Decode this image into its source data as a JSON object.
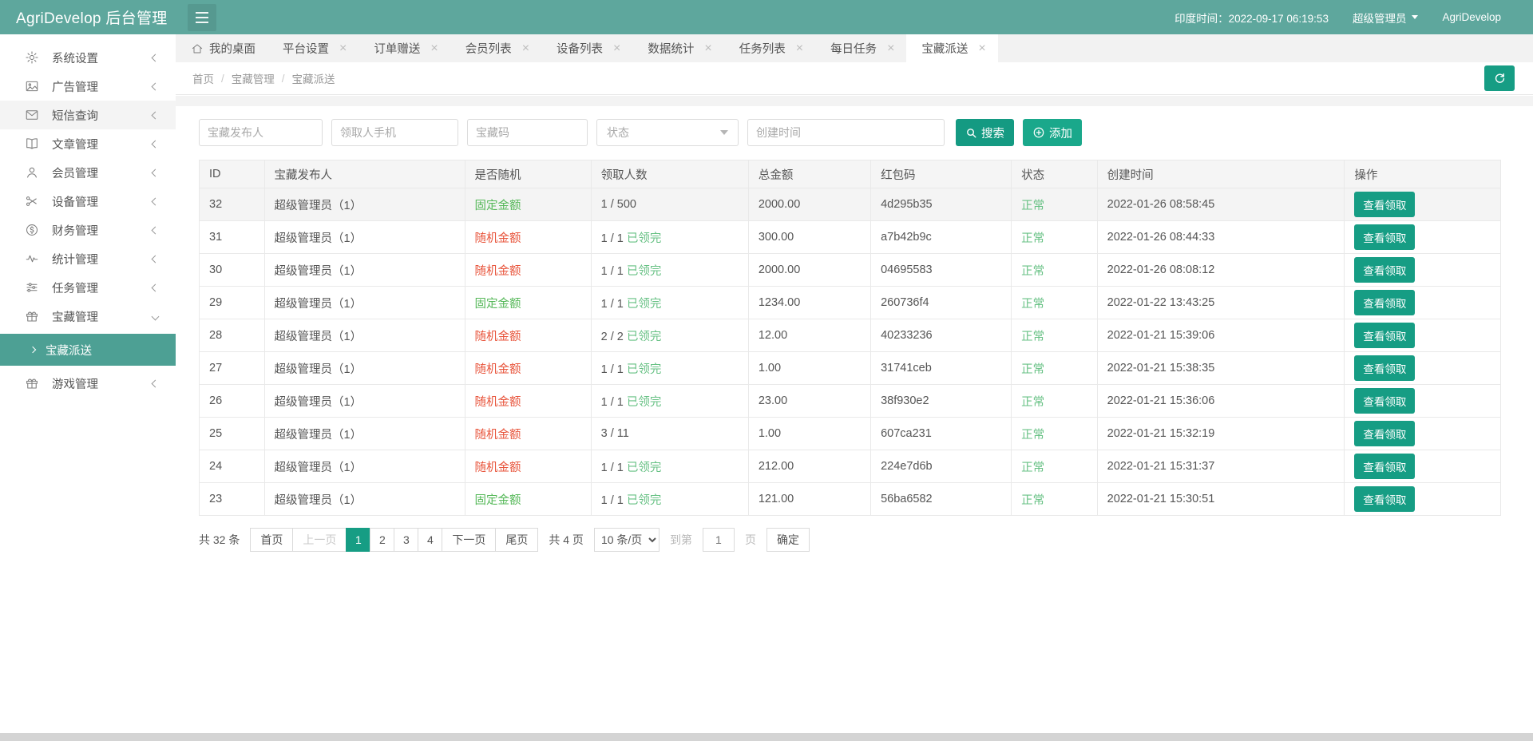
{
  "colors": {
    "header_bg": "#5ea79d",
    "accent_teal": "#169d84",
    "add_green": "#1aa88b",
    "submenu_bg": "#4da094",
    "fixed_amount_green": "#55b858",
    "claimed_green": "#67c184",
    "random_amount_red": "#e8553c"
  },
  "header": {
    "title": "AgriDevelop 后台管理",
    "time_label": "印度时间：",
    "time_value": "2022-09-17 06:19:53",
    "user": "超级管理员",
    "brand": "AgriDevelop"
  },
  "sidebar": {
    "items": [
      {
        "label": "系统设置",
        "icon": "gear-icon",
        "state": "collapsed"
      },
      {
        "label": "广告管理",
        "icon": "image-icon",
        "state": "collapsed"
      },
      {
        "label": "短信查询",
        "icon": "mail-icon",
        "state": "collapsed",
        "highlight": true
      },
      {
        "label": "文章管理",
        "icon": "book-icon",
        "state": "collapsed"
      },
      {
        "label": "会员管理",
        "icon": "user-icon",
        "state": "collapsed"
      },
      {
        "label": "设备管理",
        "icon": "tools-icon",
        "state": "collapsed"
      },
      {
        "label": "财务管理",
        "icon": "finance-icon",
        "state": "collapsed"
      },
      {
        "label": "统计管理",
        "icon": "stats-icon",
        "state": "collapsed"
      },
      {
        "label": "任务管理",
        "icon": "tasks-icon",
        "state": "collapsed"
      },
      {
        "label": "宝藏管理",
        "icon": "gift-icon",
        "state": "expanded",
        "children": [
          {
            "label": "宝藏派送",
            "active": true
          }
        ]
      },
      {
        "label": "游戏管理",
        "icon": "gift-icon",
        "state": "collapsed"
      }
    ]
  },
  "tabs": [
    {
      "label": "我的桌面",
      "icon": "home-icon",
      "closable": false,
      "active": false
    },
    {
      "label": "平台设置",
      "closable": true,
      "active": false
    },
    {
      "label": "订单赠送",
      "closable": true,
      "active": false
    },
    {
      "label": "会员列表",
      "closable": true,
      "active": false
    },
    {
      "label": "设备列表",
      "closable": true,
      "active": false
    },
    {
      "label": "数据统计",
      "closable": true,
      "active": false
    },
    {
      "label": "任务列表",
      "closable": true,
      "active": false
    },
    {
      "label": "每日任务",
      "closable": true,
      "active": false
    },
    {
      "label": "宝藏派送",
      "closable": true,
      "active": true
    }
  ],
  "breadcrumb": [
    "首页",
    "宝藏管理",
    "宝藏派送"
  ],
  "filters": {
    "publisher_placeholder": "宝藏发布人",
    "phone_placeholder": "领取人手机",
    "code_placeholder": "宝藏码",
    "status_placeholder": "状态",
    "created_placeholder": "创建时间",
    "search_label": "搜索",
    "add_label": "添加"
  },
  "table": {
    "columns": [
      "ID",
      "宝藏发布人",
      "是否随机",
      "领取人数",
      "总金额",
      "红包码",
      "状态",
      "创建时间",
      "操作"
    ],
    "action_label": "查看领取",
    "rows": [
      {
        "id": "32",
        "publisher": "超级管理员（1）",
        "random": "固定金额",
        "random_type": "fixed",
        "claim": "1 / 500",
        "claim_done": "",
        "amount": "2000.00",
        "code": "4d295b35",
        "status": "正常",
        "created": "2022-01-26 08:58:45"
      },
      {
        "id": "31",
        "publisher": "超级管理员（1）",
        "random": "随机金额",
        "random_type": "random",
        "claim": "1 / 1",
        "claim_done": "已领完",
        "amount": "300.00",
        "code": "a7b42b9c",
        "status": "正常",
        "created": "2022-01-26 08:44:33"
      },
      {
        "id": "30",
        "publisher": "超级管理员（1）",
        "random": "随机金额",
        "random_type": "random",
        "claim": "1 / 1",
        "claim_done": "已领完",
        "amount": "2000.00",
        "code": "04695583",
        "status": "正常",
        "created": "2022-01-26 08:08:12"
      },
      {
        "id": "29",
        "publisher": "超级管理员（1）",
        "random": "固定金额",
        "random_type": "fixed",
        "claim": "1 / 1",
        "claim_done": "已领完",
        "amount": "1234.00",
        "code": "260736f4",
        "status": "正常",
        "created": "2022-01-22 13:43:25"
      },
      {
        "id": "28",
        "publisher": "超级管理员（1）",
        "random": "随机金额",
        "random_type": "random",
        "claim": "2 / 2",
        "claim_done": "已领完",
        "amount": "12.00",
        "code": "40233236",
        "status": "正常",
        "created": "2022-01-21 15:39:06"
      },
      {
        "id": "27",
        "publisher": "超级管理员（1）",
        "random": "随机金额",
        "random_type": "random",
        "claim": "1 / 1",
        "claim_done": "已领完",
        "amount": "1.00",
        "code": "31741ceb",
        "status": "正常",
        "created": "2022-01-21 15:38:35"
      },
      {
        "id": "26",
        "publisher": "超级管理员（1）",
        "random": "随机金额",
        "random_type": "random",
        "claim": "1 / 1",
        "claim_done": "已领完",
        "amount": "23.00",
        "code": "38f930e2",
        "status": "正常",
        "created": "2022-01-21 15:36:06"
      },
      {
        "id": "25",
        "publisher": "超级管理员（1）",
        "random": "随机金额",
        "random_type": "random",
        "claim": "3 / 11",
        "claim_done": "",
        "amount": "1.00",
        "code": "607ca231",
        "status": "正常",
        "created": "2022-01-21 15:32:19"
      },
      {
        "id": "24",
        "publisher": "超级管理员（1）",
        "random": "随机金额",
        "random_type": "random",
        "claim": "1 / 1",
        "claim_done": "已领完",
        "amount": "212.00",
        "code": "224e7d6b",
        "status": "正常",
        "created": "2022-01-21 15:31:37"
      },
      {
        "id": "23",
        "publisher": "超级管理员（1）",
        "random": "固定金额",
        "random_type": "fixed",
        "claim": "1 / 1",
        "claim_done": "已领完",
        "amount": "121.00",
        "code": "56ba6582",
        "status": "正常",
        "created": "2022-01-21 15:30:51"
      }
    ]
  },
  "pagination": {
    "total": "共 32 条",
    "first": "首页",
    "prev": "上一页",
    "pages": [
      "1",
      "2",
      "3",
      "4"
    ],
    "active_page": "1",
    "next": "下一页",
    "last": "尾页",
    "total_pages": "共 4 页",
    "page_size": "10 条/页",
    "goto_prefix": "到第",
    "goto_value": "1",
    "goto_suffix": "页",
    "confirm": "确定"
  }
}
